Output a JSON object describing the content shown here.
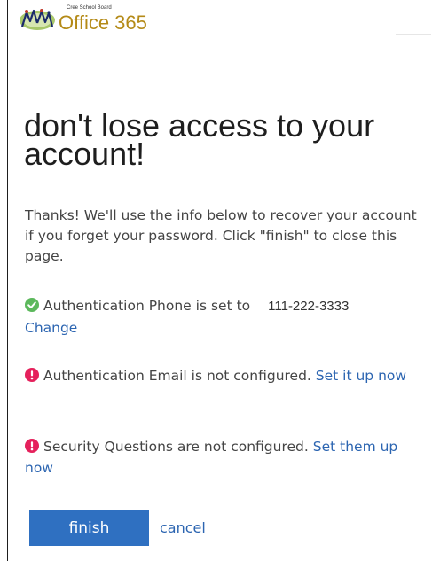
{
  "header": {
    "logo_icon": "cree-school-board-logo-icon",
    "org_name": "Cree School Board",
    "product_name": "Office 365"
  },
  "main": {
    "title": "don't lose access to your account!",
    "intro": "Thanks! We'll use the info below to recover your account if you forget your password. Click \"finish\" to close this page.",
    "items": [
      {
        "status": "ok",
        "status_icon": "check-circle-icon",
        "status_color": "#5cb85c",
        "text": "Authentication Phone is set to",
        "value": "111-222-3333",
        "link_label": "Change"
      },
      {
        "status": "error",
        "status_icon": "exclamation-circle-icon",
        "status_color": "#e5215c",
        "text": "Authentication Email is not configured.",
        "link_label": "Set it up now"
      },
      {
        "status": "error",
        "status_icon": "exclamation-circle-icon",
        "status_color": "#e5215c",
        "text": "Security Questions are not configured.",
        "link_label": "Set them up now"
      }
    ]
  },
  "actions": {
    "finish_label": "finish",
    "cancel_label": "cancel"
  },
  "colors": {
    "accent": "#2f70c1",
    "link": "#2c65b1",
    "brand": "#b48a17"
  }
}
